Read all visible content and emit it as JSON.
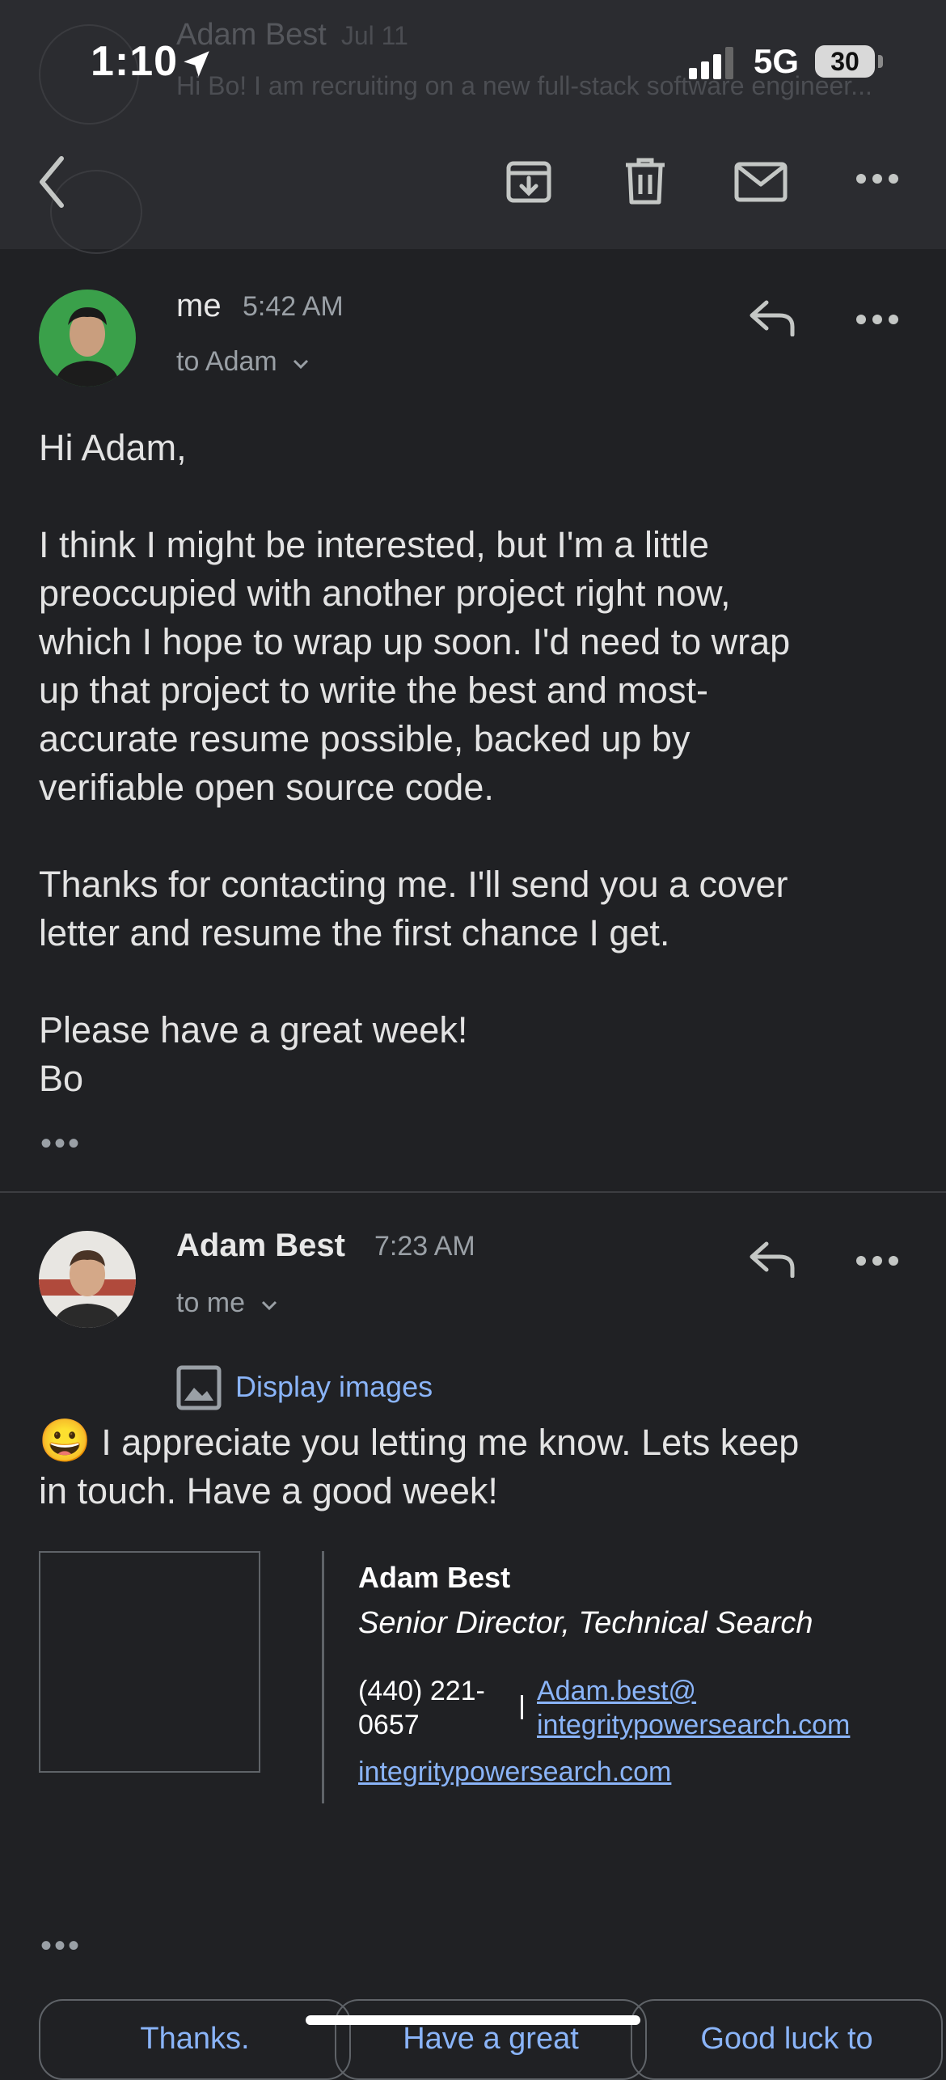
{
  "status_bar": {
    "time": "1:10",
    "network": "5G",
    "battery": "30"
  },
  "background_thread": {
    "sender": "Adam Best",
    "date": "Jul 11",
    "preview": "Hi Bo! I am recruiting on a new full-stack software engineer..."
  },
  "toolbar": {
    "icons": [
      "back-arrow-icon",
      "archive-icon",
      "trash-icon",
      "mail-icon",
      "more-icon"
    ]
  },
  "message1": {
    "sender": "me",
    "time": "5:42 AM",
    "to": "to Adam",
    "body": [
      "Hi Adam,",
      "",
      "I think I might be interested, but I'm a little",
      "preoccupied with another project right now,",
      "which I hope to wrap up soon. I'd need to wrap",
      "up that project to write the best and most-",
      "accurate resume possible, backed up by",
      "verifiable open source code.",
      "",
      "Thanks for contacting me. I'll send you a cover",
      "letter and resume the first chance I get.",
      "",
      "Please have a great week!",
      "Bo"
    ],
    "trimmed": "•••"
  },
  "message2": {
    "sender": "Adam Best",
    "time": "7:23 AM",
    "to": "to me",
    "display_images": "Display images",
    "emoji": "😀",
    "body": [
      "I appreciate you letting me know. Lets keep",
      "in touch. Have a good week!"
    ],
    "signature": {
      "name": "Adam Best",
      "title": "Senior Director, Technical Search",
      "phone": "(440) 221-0657",
      "email_line1": "Adam.best@",
      "email_line2": "integritypowersearch.com",
      "website": "integritypowersearch.com"
    },
    "trimmed": "•••"
  },
  "smart_replies": [
    "Thanks.",
    "Have a great",
    "Good luck to"
  ],
  "colors": {
    "background": "#202124",
    "header": "#2b2c30",
    "link": "#8ab4f8",
    "muted": "#9aa0a6"
  }
}
